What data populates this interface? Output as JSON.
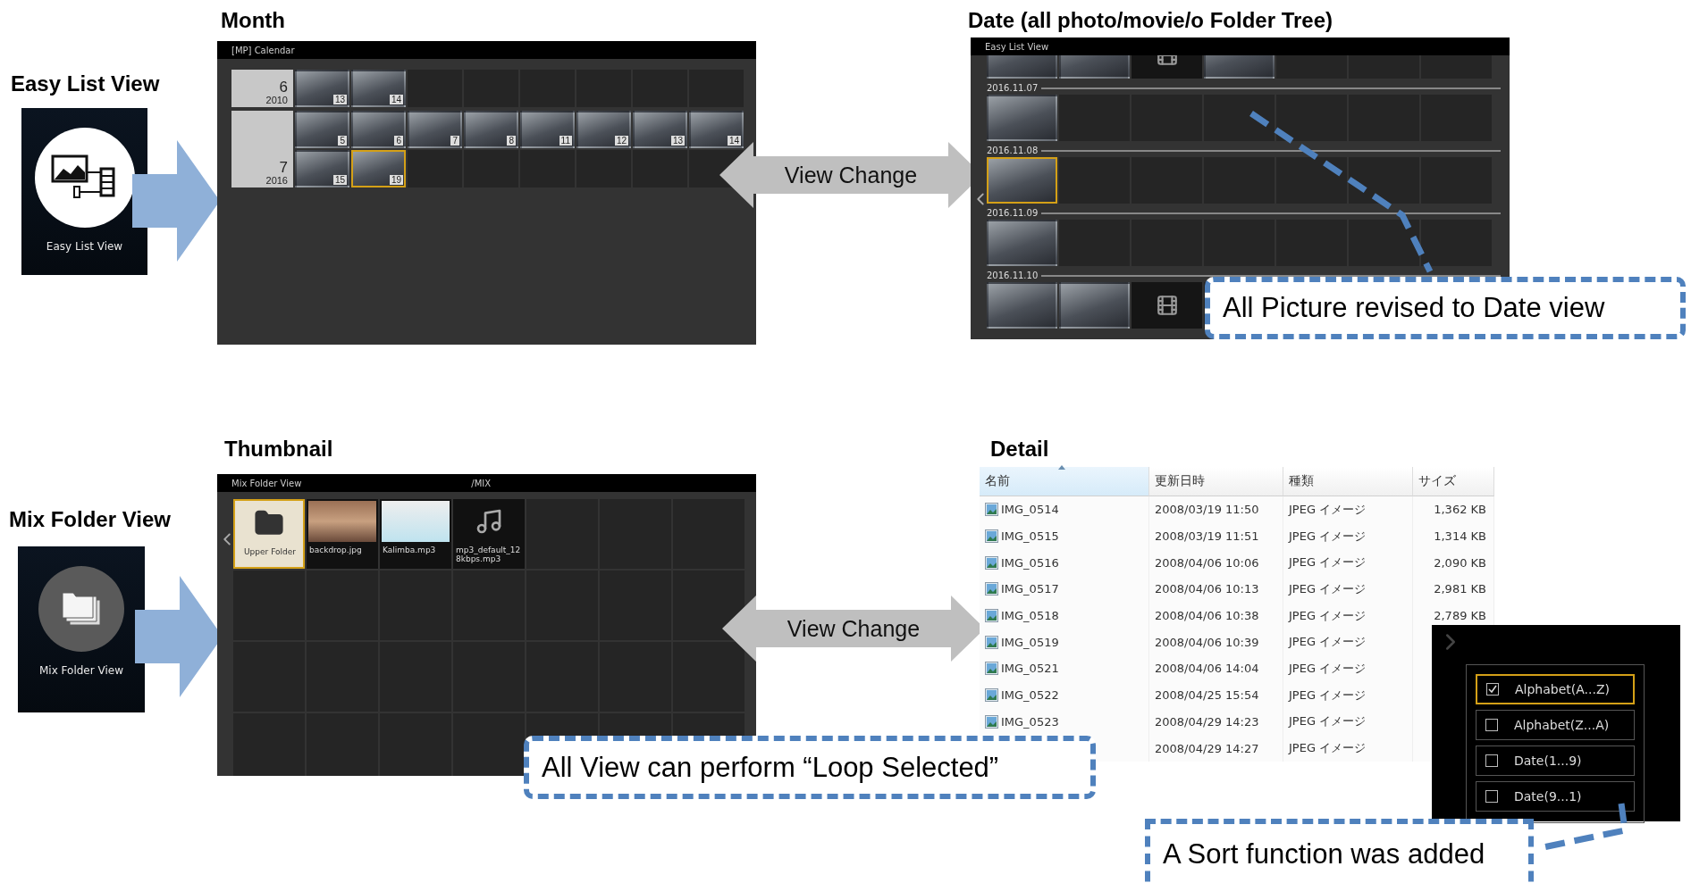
{
  "easy_list_view": {
    "heading": "Easy List View",
    "tile_label": "Easy List View"
  },
  "month": {
    "heading": "Month",
    "window_title": "[MP] Calendar",
    "groups": [
      {
        "month": "6",
        "year": "2010",
        "photos": [
          {
            "day": "13",
            "selected": false
          },
          {
            "day": "14",
            "selected": false
          }
        ]
      },
      {
        "month": "7",
        "year": "2016",
        "photos": [
          {
            "day": "5",
            "selected": false
          },
          {
            "day": "6",
            "selected": false
          },
          {
            "day": "7",
            "selected": false
          },
          {
            "day": "8",
            "selected": false
          },
          {
            "day": "11",
            "selected": false
          },
          {
            "day": "12",
            "selected": false
          },
          {
            "day": "13",
            "selected": false
          },
          {
            "day": "14",
            "selected": false
          },
          {
            "day": "15",
            "selected": false
          },
          {
            "day": "19",
            "selected": true
          }
        ]
      }
    ]
  },
  "view_change_top": {
    "label": "View Change"
  },
  "date_view": {
    "heading": "Date (all photo/movie/o Folder Tree)",
    "window_title": "Easy List View",
    "days": [
      {
        "items": [
          {
            "kind": "photo",
            "selected": false
          },
          {
            "kind": "photo",
            "selected": false
          },
          {
            "kind": "video",
            "selected": false
          },
          {
            "kind": "photo",
            "selected": false
          }
        ]
      },
      {
        "date": "2016.11.07",
        "items": [
          {
            "kind": "photo",
            "selected": false
          }
        ]
      },
      {
        "date": "2016.11.08",
        "items": [
          {
            "kind": "photo",
            "selected": true
          }
        ]
      },
      {
        "date": "2016.11.09",
        "items": [
          {
            "kind": "photo",
            "selected": false
          }
        ]
      },
      {
        "date": "2016.11.10",
        "items": [
          {
            "kind": "photo",
            "selected": false
          },
          {
            "kind": "photo",
            "selected": false
          },
          {
            "kind": "video",
            "selected": false
          }
        ]
      }
    ]
  },
  "date_callout": {
    "text": "All Picture revised to Date view"
  },
  "mix_folder_view": {
    "heading": "Mix Folder View",
    "tile_label": "Mix Folder View"
  },
  "thumbnail": {
    "heading": "Thumbnail",
    "window_title": "Mix Folder View",
    "path": "/MIX",
    "items": [
      {
        "kind": "folder",
        "name": "Upper Folder",
        "selected": true
      },
      {
        "kind": "photo",
        "name": "backdrop.jpg",
        "selected": false
      },
      {
        "kind": "album",
        "name": "Kalimba.mp3",
        "selected": false
      },
      {
        "kind": "audio",
        "name": "mp3_default_128kbps.mp3",
        "selected": false
      }
    ]
  },
  "view_change_bottom": {
    "label": "View Change"
  },
  "loop_callout": {
    "text": "All View can perform “Loop Selected”"
  },
  "detail": {
    "heading": "Detail",
    "columns": [
      {
        "label": "名前",
        "sorted": true
      },
      {
        "label": "更新日時",
        "sorted": false
      },
      {
        "label": "種類",
        "sorted": false
      },
      {
        "label": "サイズ",
        "sorted": false
      }
    ],
    "rows": [
      {
        "name": "IMG_0514",
        "modified": "2008/03/19 11:50",
        "type": "JPEG イメージ",
        "size": "1,362 KB"
      },
      {
        "name": "IMG_0515",
        "modified": "2008/03/19 11:51",
        "type": "JPEG イメージ",
        "size": "1,314 KB"
      },
      {
        "name": "IMG_0516",
        "modified": "2008/04/06 10:06",
        "type": "JPEG イメージ",
        "size": "2,090 KB"
      },
      {
        "name": "IMG_0517",
        "modified": "2008/04/06 10:13",
        "type": "JPEG イメージ",
        "size": "2,981 KB"
      },
      {
        "name": "IMG_0518",
        "modified": "2008/04/06 10:38",
        "type": "JPEG イメージ",
        "size": "2,789 KB"
      },
      {
        "name": "IMG_0519",
        "modified": "2008/04/06 10:39",
        "type": "JPEG イメージ"
      },
      {
        "name": "IMG_0521",
        "modified": "2008/04/06 14:04",
        "type": "JPEG イメージ"
      },
      {
        "name": "IMG_0522",
        "modified": "2008/04/25 15:54",
        "type": "JPEG イメージ"
      },
      {
        "name": "IMG_0523",
        "modified": "2008/04/29 14:23",
        "type": "JPEG イメージ"
      },
      {
        "modified": "2008/04/29 14:27",
        "type": "JPEG イメージ"
      }
    ]
  },
  "sort_panel": {
    "options": [
      {
        "label": "Alphabet(A...Z)",
        "checked": true,
        "selected": true
      },
      {
        "label": "Alphabet(Z...A)",
        "checked": false,
        "selected": false
      },
      {
        "label": "Date(1...9)",
        "checked": false,
        "selected": false
      },
      {
        "label": "Date(9...1)",
        "checked": false,
        "selected": false
      }
    ]
  },
  "sort_callout": {
    "text": "A Sort function was added"
  }
}
